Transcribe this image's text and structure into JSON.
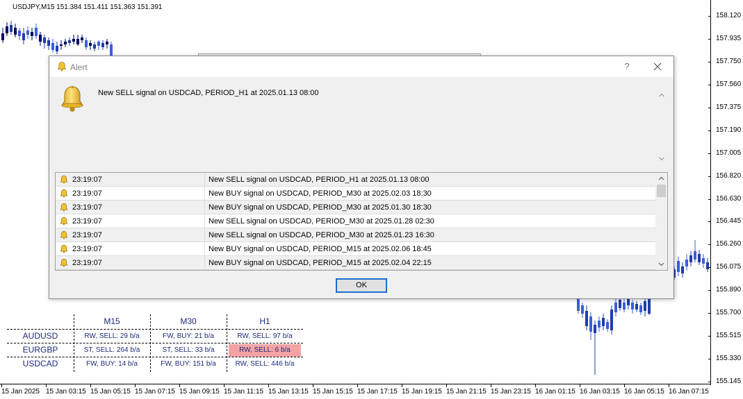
{
  "chart": {
    "header": "USDJPY,M15  151.384 151.411 151.363 151.391",
    "price_labels": [
      "158.120",
      "157.935",
      "157.750",
      "157.560",
      "157.375",
      "157.190",
      "157.005",
      "156.820",
      "156.630",
      "156.445",
      "156.260",
      "156.075",
      "155.890",
      "155.700",
      "155.515",
      "155.330",
      "155.145"
    ],
    "time_labels": [
      "15 Jan 2025",
      "15 Jan 03:15",
      "15 Jan 05:15",
      "15 Jan 07:15",
      "15 Jan 09:15",
      "15 Jan 11:15",
      "15 Jan 13:15",
      "15 Jan 15:15",
      "15 Jan 17:15",
      "15 Jan 19:15",
      "15 Jan 21:15",
      "15 Jan 23:15",
      "16 Jan 01:15",
      "16 Jan 03:15",
      "16 Jan 05:15",
      "16 Jan 07:15"
    ],
    "colors": {
      "bull": "#1e3ea8",
      "bear": "#000060",
      "bull_bright": "#3a5fd9"
    }
  },
  "mtf": {
    "headers": [
      "M15",
      "M30",
      "H1"
    ],
    "symbols": [
      "AUDUSD",
      "EURGBP",
      "USDCAD"
    ],
    "cells": [
      [
        "RW, SELL: 29 b/a",
        "FW, BUY: 21 b/a",
        "RW, SELL: 97 b/a"
      ],
      [
        "ST, SELL: 264 b/a",
        "ST, SELL: 33 b/a",
        "RW, SELL: 6 b/a"
      ],
      [
        "FW, BUY: 14 b/a",
        "FW, BUY: 151 b/a",
        "RW, SELL: 446 b/a"
      ]
    ],
    "highlight_color": "#f4a3a3"
  },
  "dialog": {
    "title": "Alert",
    "help": "?",
    "message": "New SELL signal on USDCAD, PERIOD_H1 at 2025.01.13 08:00",
    "ok_label": "OK",
    "rows": [
      {
        "time": "23:19:07",
        "msg": "New SELL signal on USDCAD, PERIOD_H1 at 2025.01.13 08:00"
      },
      {
        "time": "23:19:07",
        "msg": "New BUY signal on USDCAD, PERIOD_M30 at 2025.02.03 18:30"
      },
      {
        "time": "23:19:07",
        "msg": "New BUY signal on USDCAD, PERIOD_M30 at 2025.01.30 18:30"
      },
      {
        "time": "23:19:07",
        "msg": "New SELL signal on USDCAD, PERIOD_M30 at 2025.01.28 02:30"
      },
      {
        "time": "23:19:07",
        "msg": "New SELL signal on USDCAD, PERIOD_M30 at 2025.01.23 16:30"
      },
      {
        "time": "23:19:07",
        "msg": "New BUY signal on USDCAD, PERIOD_M15 at 2025.02.06 18:45"
      },
      {
        "time": "23:19:07",
        "msg": "New BUY signal on USDCAD, PERIOD_M15 at 2025.02.04 22:15"
      }
    ]
  }
}
